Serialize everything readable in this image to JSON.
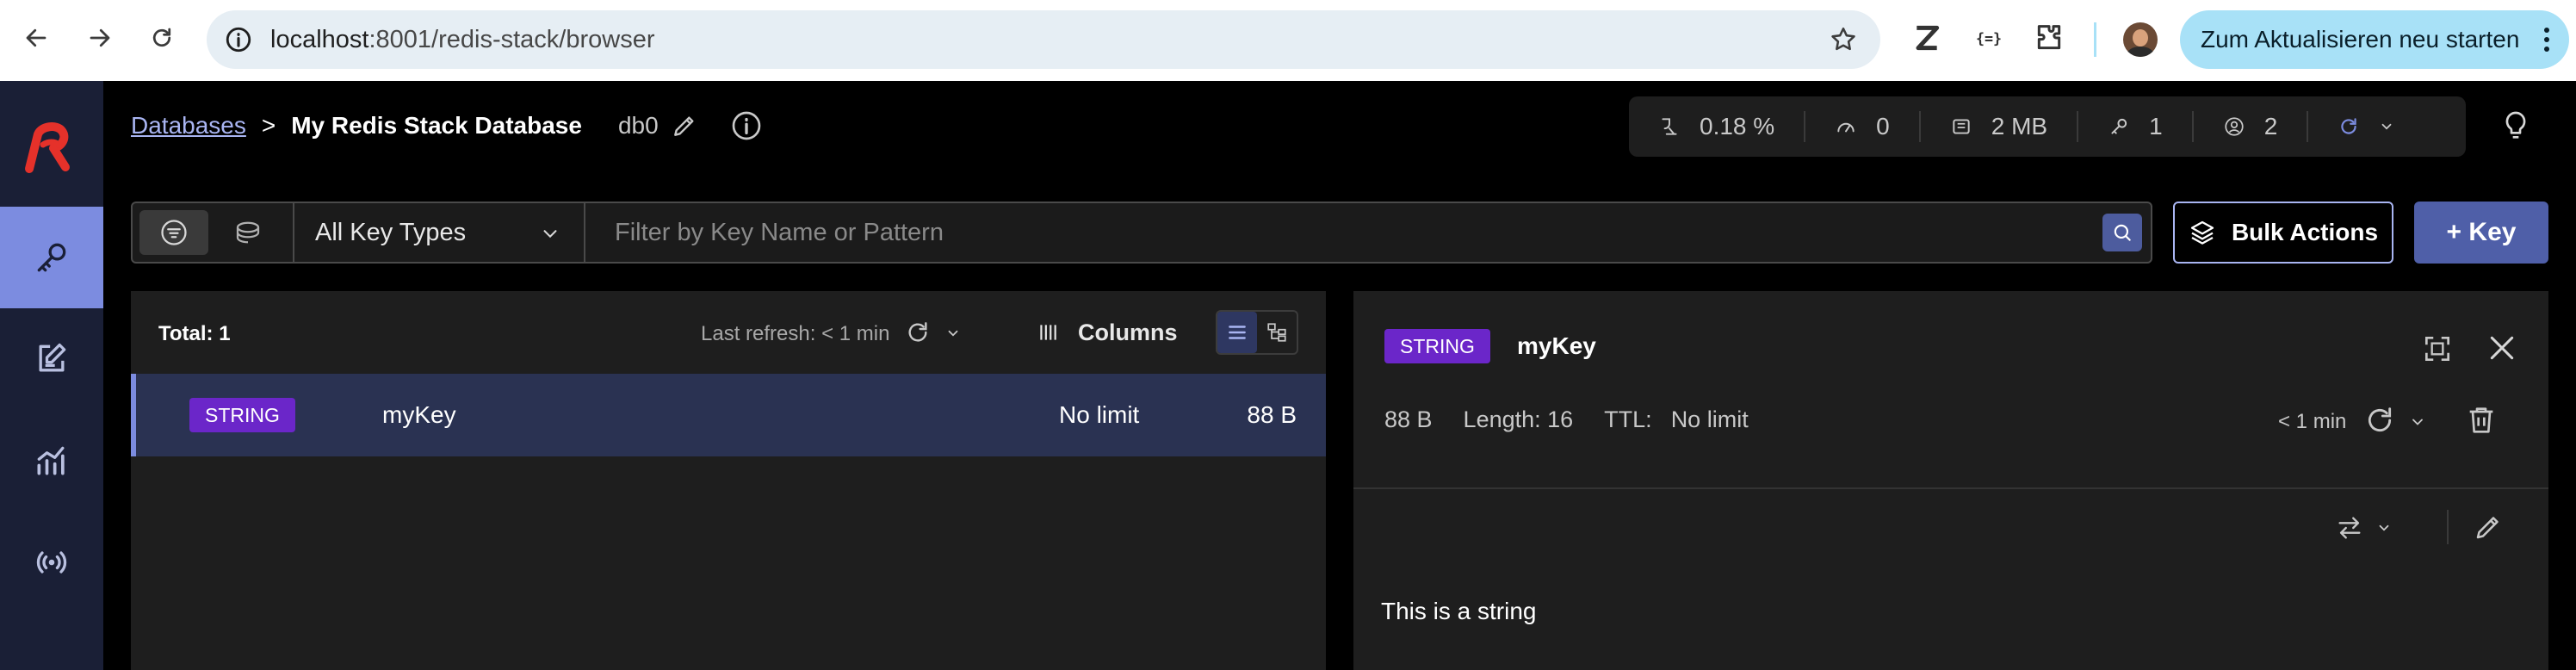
{
  "browser": {
    "url_host": "localhost",
    "url_path": ":8001/redis-stack/browser",
    "update_button": "Zum Aktualisieren neu starten"
  },
  "breadcrumb": {
    "databases_link": "Databases",
    "separator": ">",
    "database_name": "My Redis Stack Database",
    "db_index": "db0"
  },
  "stats": {
    "cpu": "0.18 %",
    "ops": "0",
    "memory": "2 MB",
    "keys": "1",
    "clients": "2"
  },
  "filter": {
    "key_type": "All Key Types",
    "search_placeholder": "Filter by Key Name or Pattern"
  },
  "actions": {
    "bulk": "Bulk Actions",
    "add_key": "+ Key"
  },
  "key_list": {
    "total": "Total: 1",
    "last_refresh": "Last refresh: < 1 min",
    "columns": "Columns",
    "rows": [
      {
        "type": "STRING",
        "name": "myKey",
        "ttl": "No limit",
        "size": "88 B"
      }
    ]
  },
  "details": {
    "type": "STRING",
    "name": "myKey",
    "size": "88 B",
    "length": "Length: 16",
    "ttl_label": "TTL:",
    "ttl_value": "No limit",
    "updated": "< 1 min",
    "value": "This is a string"
  },
  "colors": {
    "accent": "#7c8ce0",
    "sidebar": "#1a1f36",
    "string_badge": "#6b26c9",
    "redis_red": "#e5312a"
  }
}
